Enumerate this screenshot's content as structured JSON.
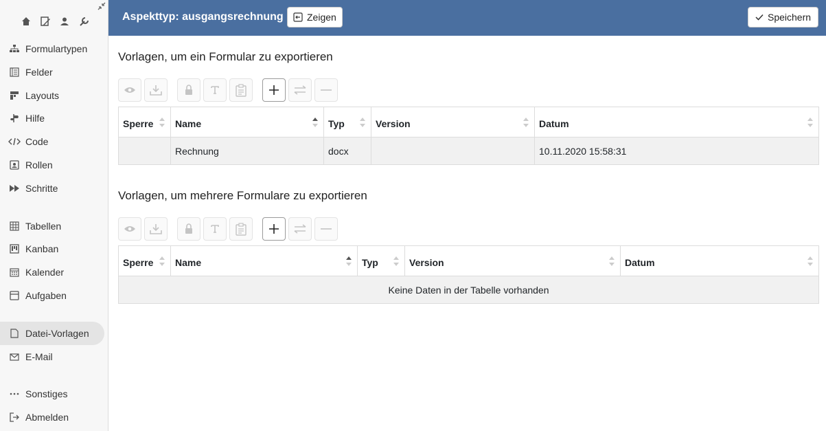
{
  "sidebar": {
    "top_icons": [
      "home-icon",
      "edit-doc-icon",
      "user-icon",
      "wrench-icon"
    ],
    "items": [
      {
        "label": "Formulartypen",
        "icon": "sitemap-icon"
      },
      {
        "label": "Felder",
        "icon": "list-icon"
      },
      {
        "label": "Layouts",
        "icon": "layout-icon"
      },
      {
        "label": "Hilfe",
        "icon": "signpost-icon"
      },
      {
        "label": "Code",
        "icon": "code-icon"
      },
      {
        "label": "Rollen",
        "icon": "person-badge-icon"
      },
      {
        "label": "Schritte",
        "icon": "fast-forward-icon"
      },
      {
        "label": "Tabellen",
        "icon": "table-icon"
      },
      {
        "label": "Kanban",
        "icon": "kanban-icon"
      },
      {
        "label": "Kalender",
        "icon": "calendar-icon"
      },
      {
        "label": "Aufgaben",
        "icon": "task-icon"
      },
      {
        "label": "Datei-Vorlagen",
        "icon": "file-icon"
      },
      {
        "label": "E-Mail",
        "icon": "envelope-icon"
      },
      {
        "label": "Sonstiges",
        "icon": "dots-icon"
      },
      {
        "label": "Abmelden",
        "icon": "logout-icon"
      }
    ],
    "active": "Datei-Vorlagen"
  },
  "header": {
    "aspect_label": "Aspekttyp: ausgangsrechnung",
    "show_button": "Zeigen",
    "save_button": "Speichern",
    "bg_color": "#4a6fa0"
  },
  "section1": {
    "title": "Vorlagen, um ein Formular zu exportieren",
    "columns": [
      "Sperre",
      "Name",
      "Typ",
      "Version",
      "Datum"
    ],
    "rows": [
      {
        "sperre": "",
        "name": "Rechnung",
        "typ": "docx",
        "version": "",
        "datum": "10.11.2020 15:58:31"
      }
    ]
  },
  "section2": {
    "title": "Vorlagen, um mehrere Formulare zu exportieren",
    "columns": [
      "Sperre",
      "Name",
      "Typ",
      "Version",
      "Datum"
    ],
    "empty_text": "Keine Daten in der Tabelle vorhanden"
  }
}
